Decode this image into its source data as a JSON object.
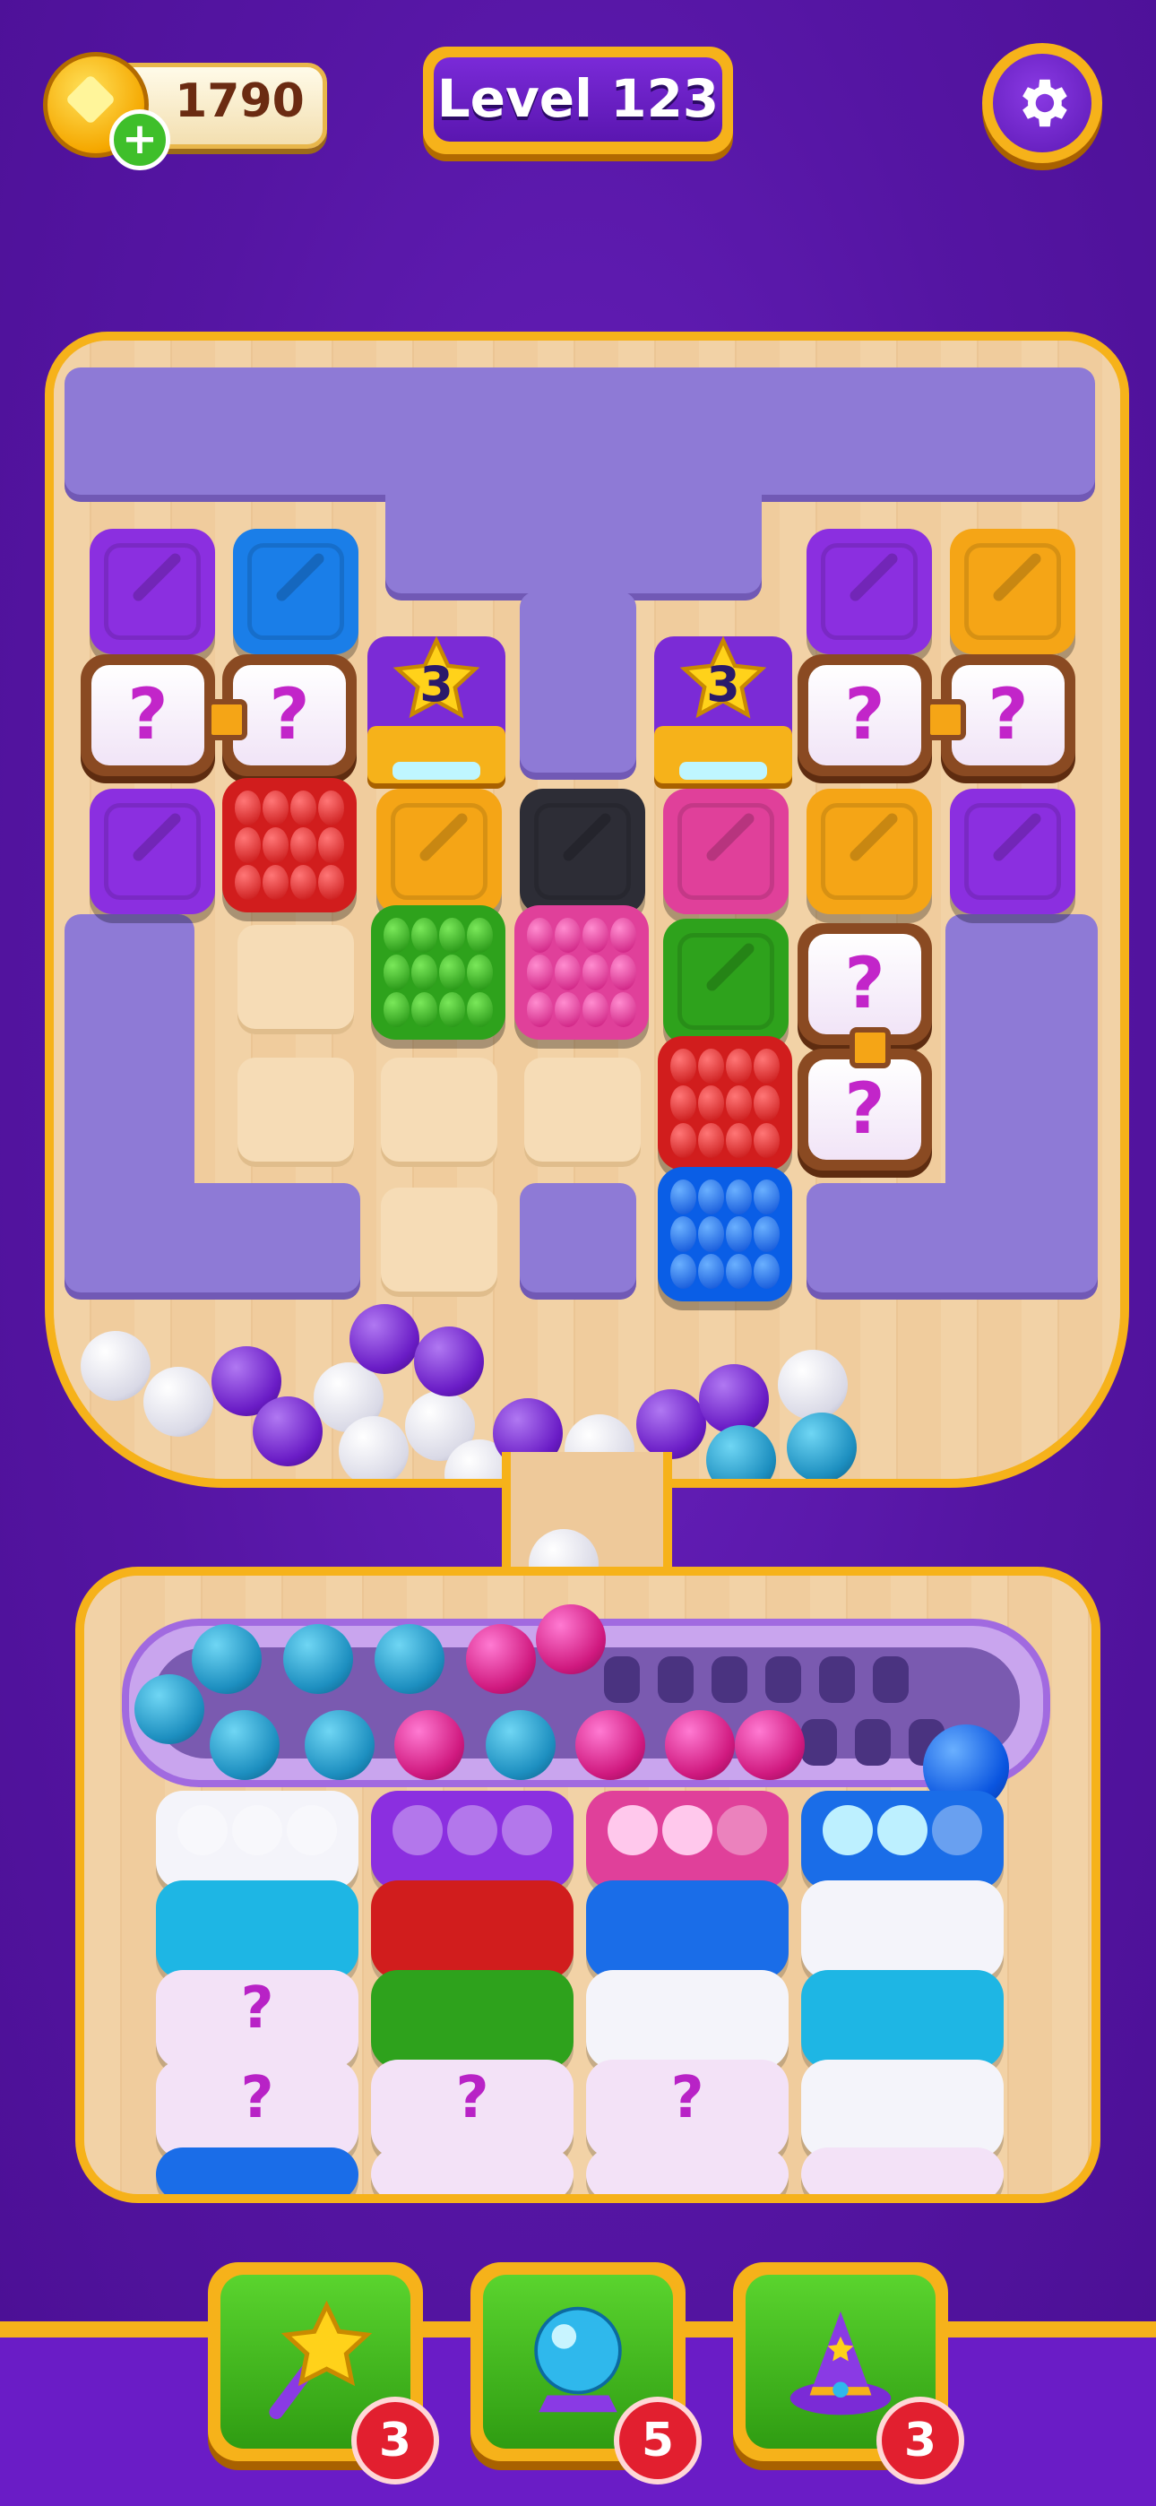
{
  "header": {
    "coins": "1790",
    "level_label": "Level 123"
  },
  "board": {
    "star_box_count": "3",
    "mystery_symbol": "?"
  },
  "tray": {
    "mystery_symbol": "?"
  },
  "boosters": [
    {
      "name": "star-wand-icon",
      "count": "3"
    },
    {
      "name": "crystal-ball-icon",
      "count": "5"
    },
    {
      "name": "wizard-hat-icon",
      "count": "3"
    }
  ],
  "colors": {
    "background": "#5a1aa8",
    "frame": "#f6b21a",
    "booster_green": "#3fb81e",
    "badge_red": "#e21f2f"
  }
}
